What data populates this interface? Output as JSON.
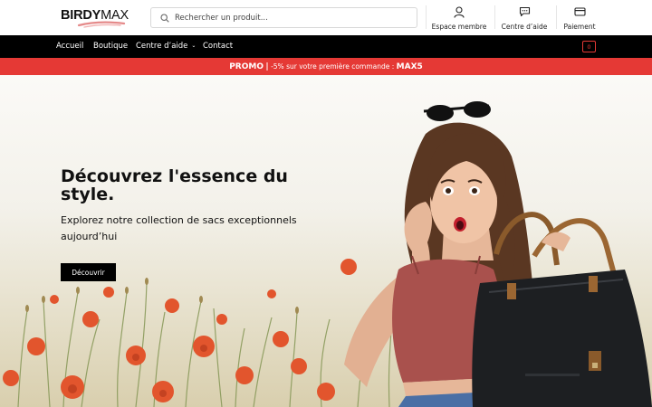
{
  "brand": {
    "part1": "BIRDY",
    "part2": "MAX"
  },
  "search": {
    "placeholder": "Rechercher un produit..."
  },
  "header_links": [
    {
      "label": "Espace membre",
      "icon": "user-icon"
    },
    {
      "label": "Centre d’aide",
      "icon": "chat-icon"
    },
    {
      "label": "Paiement",
      "icon": "credit-card-icon"
    }
  ],
  "nav": {
    "items": [
      "Accueil",
      "Boutique",
      "Centre d’aide",
      "Contact"
    ],
    "cart_count": "0"
  },
  "promo": {
    "label": "PROMO",
    "separator": "|",
    "text": "-5% sur votre première commande :",
    "code": "MAX5"
  },
  "hero": {
    "title": "Découvrez l'essence du style.",
    "subtitle": "Explorez notre collection de sacs exceptionnels aujourd’hui",
    "cta": "Découvrir"
  },
  "colors": {
    "accent": "#e53935",
    "nav_bg": "#000000"
  }
}
